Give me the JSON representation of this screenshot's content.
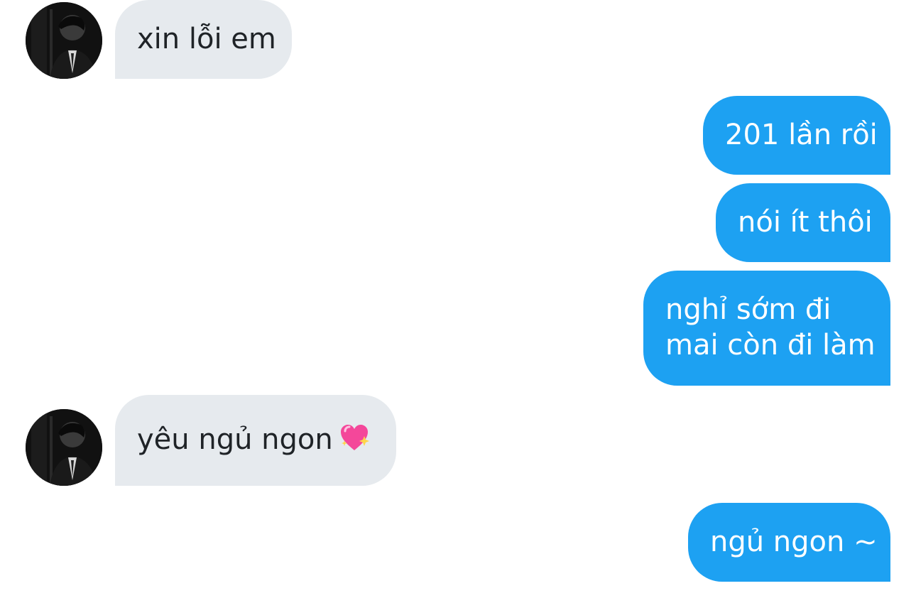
{
  "conversation": {
    "messages": [
      {
        "side": "incoming",
        "text": "xin lỗi em"
      },
      {
        "side": "outgoing",
        "text": "201 lần rồi"
      },
      {
        "side": "outgoing",
        "text": "nói ít thôi"
      },
      {
        "side": "outgoing",
        "lines": [
          "nghỉ sớm đi",
          "mai còn đi làm"
        ]
      },
      {
        "side": "incoming",
        "text": "yêu ngủ ngon",
        "emoji": "sparkling-heart-icon"
      },
      {
        "side": "outgoing",
        "text": "ngủ ngon ~"
      }
    ]
  },
  "colors": {
    "incoming_bubble": "#e6eaee",
    "incoming_text": "#1f2327",
    "outgoing_bubble": "#1da1f2",
    "outgoing_text": "#ffffff",
    "heart": "#f4479a"
  },
  "avatar": {
    "icon": "user-avatar-icon"
  }
}
